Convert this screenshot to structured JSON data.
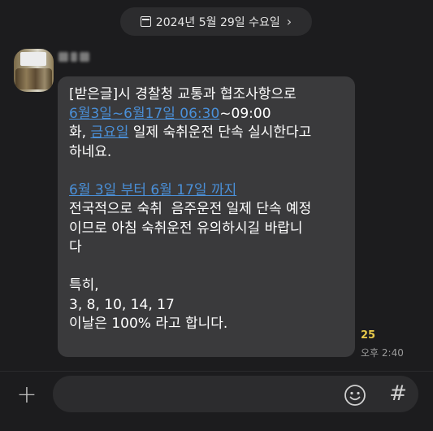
{
  "date_header": {
    "label": "2024년 5월 29일 수요일",
    "calendar_icon": "calendar-icon",
    "chevron_icon": "chevron-right-icon"
  },
  "message": {
    "line1": "[받은글]시 경찰청 교통과 협조사항으로",
    "line2_link": "6월3일~6월17일 06:30",
    "line2_rest": "~09:00",
    "line3_pre": "화, ",
    "line3_link": "금요일",
    "line3_rest": " 일제 숙취운전 단속 실시한다고",
    "line4": "하네요.",
    "line5_link": "6월 3일 부터 6월 17일 까지",
    "line6": "전국적으로 숙취  음주운전 일제 단속 예정",
    "line7": "이므로 아침 숙취운전 유의하시길 바랍니",
    "line8": "다",
    "line9": "특히,",
    "line10": "3, 8, 10, 14, 17",
    "line11": "이날은 100% 라고 합니다.",
    "link_color": "#4a90d9"
  },
  "meta": {
    "read_count": "25",
    "time": "오후 2:40",
    "read_count_color": "#e6c84a"
  },
  "input": {
    "plus_label": "+",
    "placeholder": "",
    "emoji_icon": "smiley-icon",
    "hash_label": "#"
  },
  "colors": {
    "background": "#1c1c1e",
    "bubble": "#3a3a3c",
    "pill": "#2c2c2e"
  }
}
